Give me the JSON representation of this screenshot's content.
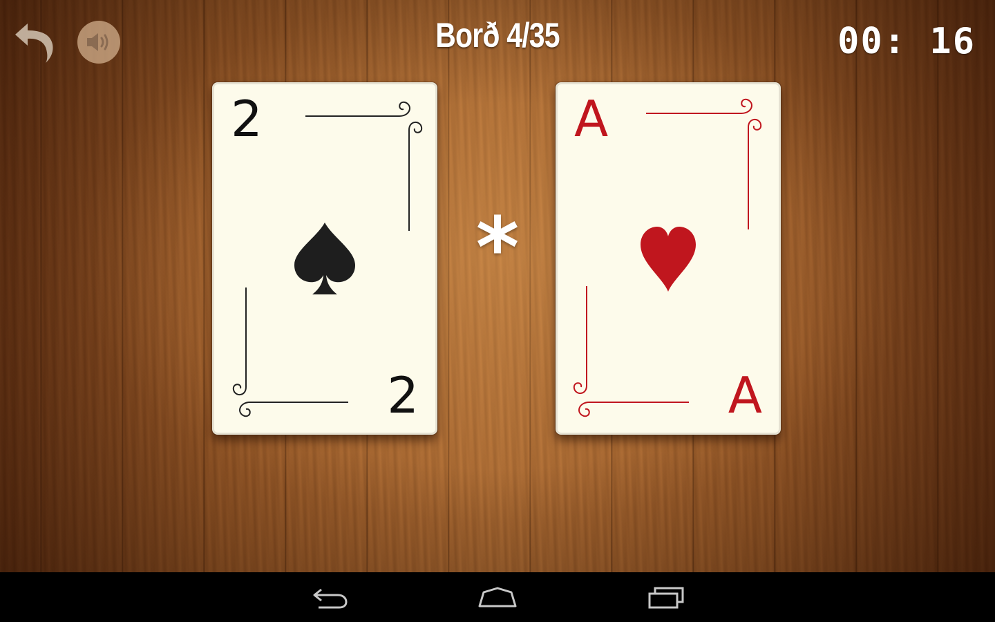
{
  "header": {
    "level_title": "Borð 4/35",
    "timer": "00: 16"
  },
  "controls": {
    "undo_icon": "undo-arrow-icon",
    "sound_icon": "speaker-icon"
  },
  "cards": [
    {
      "rank": "2",
      "suit": "spades",
      "color": "#111111"
    },
    {
      "rank": "A",
      "suit": "hearts",
      "color": "#c0161e"
    }
  ],
  "operator": "*",
  "nav_bar": {
    "back_icon": "back-icon",
    "home_icon": "home-icon",
    "recent_apps_icon": "recent-apps-icon"
  }
}
